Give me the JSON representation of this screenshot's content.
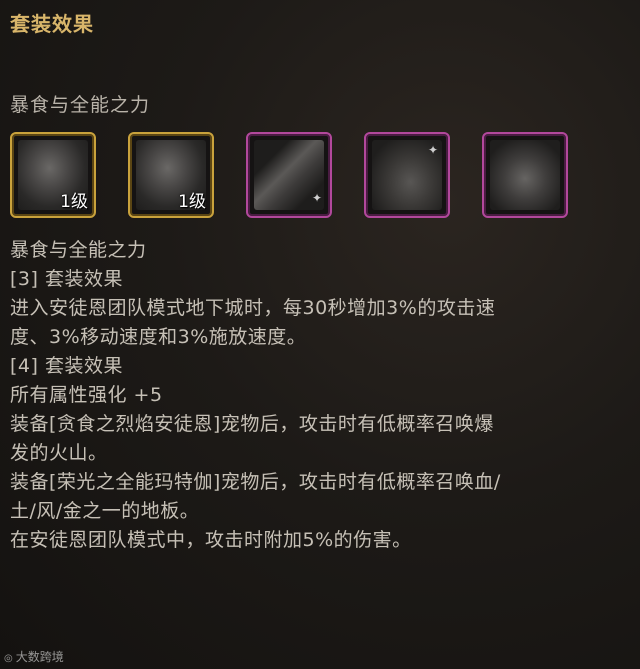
{
  "panel": {
    "title": "套装效果",
    "set_name": "暴食与全能之力"
  },
  "slots": [
    {
      "frame": "gold",
      "art": "creature-icon",
      "level": "1级"
    },
    {
      "frame": "gold",
      "art": "chibi-creature-icon",
      "level": "1级"
    },
    {
      "frame": "purple",
      "art": "cloth-icon",
      "level": ""
    },
    {
      "frame": "purple",
      "art": "rock-icon",
      "level": ""
    },
    {
      "frame": "purple",
      "art": "ore-icon",
      "level": ""
    }
  ],
  "colors": {
    "title": "#d8b56a",
    "gold_frame": "#c9a23c",
    "purple_frame": "#b2489c",
    "text": "#c6c0b6"
  },
  "description": {
    "set_name": "暴食与全能之力",
    "tier3_header": "[3] 套装效果",
    "tier3_line1": "进入安徒恩团队模式地下城时，每30秒增加3%的攻击速",
    "tier3_line2": "度、3%移动速度和3%施放速度。",
    "tier4_header": "[4] 套装效果",
    "tier4_line1": "所有属性强化 +5",
    "tier4_line2": "装备[贪食之烈焰安徒恩]宠物后，攻击时有低概率召唤爆",
    "tier4_line3": "发的火山。",
    "tier4_line4": "装备[荣光之全能玛特伽]宠物后，攻击时有低概率召唤血/",
    "tier4_line5": "土/风/金之一的地板。",
    "tier4_line6": "在安徒恩团队模式中，攻击时附加5%的伤害。"
  },
  "watermark": {
    "text": "大数跨境"
  }
}
